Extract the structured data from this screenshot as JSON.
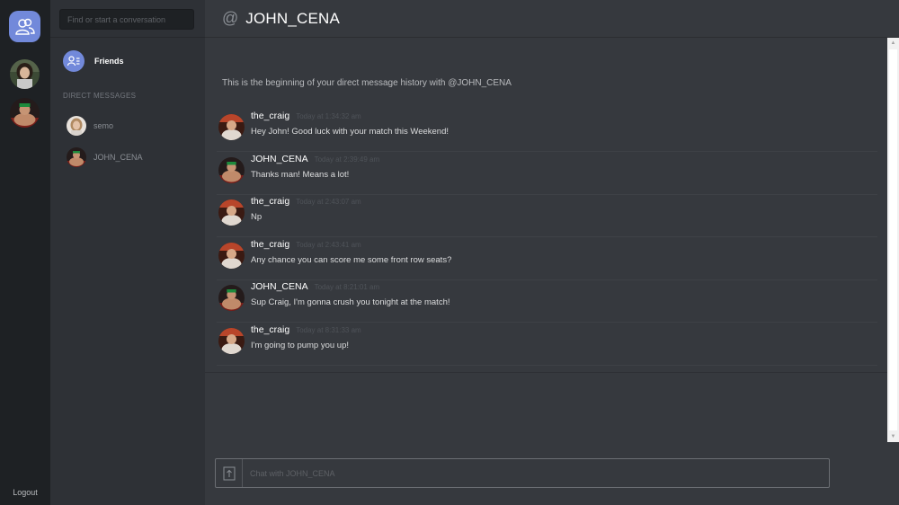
{
  "rail": {
    "home_icon": "friends-icon",
    "servers": [
      {
        "name": "semo",
        "avatar": "woman-avatar"
      },
      {
        "name": "JOHN_CENA",
        "avatar": "wrestler-avatar"
      }
    ],
    "logout_label": "Logout"
  },
  "sidebar": {
    "search_placeholder": "Find or start a conversation",
    "friends_label": "Friends",
    "dm_header": "DIRECT MESSAGES",
    "dms": [
      {
        "name": "semo"
      },
      {
        "name": "JOHN_CENA"
      }
    ]
  },
  "main": {
    "at_symbol": "@",
    "title": "JOHN_CENA",
    "beginning_text": "This is the beginning of your direct message history with @JOHN_CENA",
    "messages": [
      {
        "author": "the_craig",
        "time": "Today at 1:34:32 am",
        "text": "Hey John! Good luck with your match this Weekend!"
      },
      {
        "author": "JOHN_CENA",
        "time": "Today at 2:39:49 am",
        "text": "Thanks man! Means a lot!"
      },
      {
        "author": "the_craig",
        "time": "Today at 2:43:07 am",
        "text": "Np"
      },
      {
        "author": "the_craig",
        "time": "Today at 2:43:41 am",
        "text": "Any chance you can score me some front row seats?"
      },
      {
        "author": "JOHN_CENA",
        "time": "Today at 8:21:01 am",
        "text": "Sup Craig, I'm gonna crush you tonight at the match!"
      },
      {
        "author": "the_craig",
        "time": "Today at 8:31:33 am",
        "text": "I'm going to pump you up!"
      }
    ],
    "composer_placeholder": "Chat with JOHN_CENA"
  },
  "colors": {
    "accent": "#7289da",
    "rail_bg": "#1e2124",
    "sidebar_bg": "#2e3136",
    "main_bg": "#36393e"
  }
}
